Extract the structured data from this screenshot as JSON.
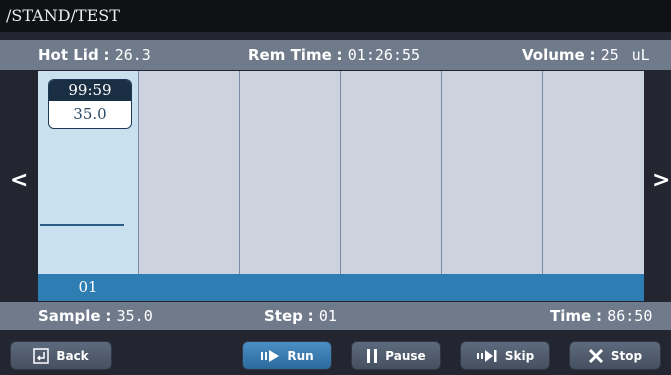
{
  "path": "/STAND/TEST",
  "info": {
    "hot_lid_label": "Hot Lid",
    "hot_lid_value": "26.3",
    "rem_time_label": "Rem Time",
    "rem_time_value": "01:26:55",
    "volume_label": "Volume",
    "volume_value": "25",
    "volume_unit": "uL"
  },
  "step": {
    "time": "99:59",
    "temp": "35.0",
    "number": "01"
  },
  "nav": {
    "prev": "<",
    "next": ">"
  },
  "status": {
    "sample_label": "Sample",
    "sample_value": "35.0",
    "step_label": "Step",
    "step_value": "01",
    "time_label": "Time",
    "time_value": "86:50"
  },
  "buttons": {
    "back": "Back",
    "run": "Run",
    "pause": "Pause",
    "skip": "Skip",
    "stop": "Stop"
  },
  "colors": {
    "info_bar": "#6f7b8b",
    "active_column": "#c9e0ef",
    "step_strip": "#2f7eb3"
  }
}
